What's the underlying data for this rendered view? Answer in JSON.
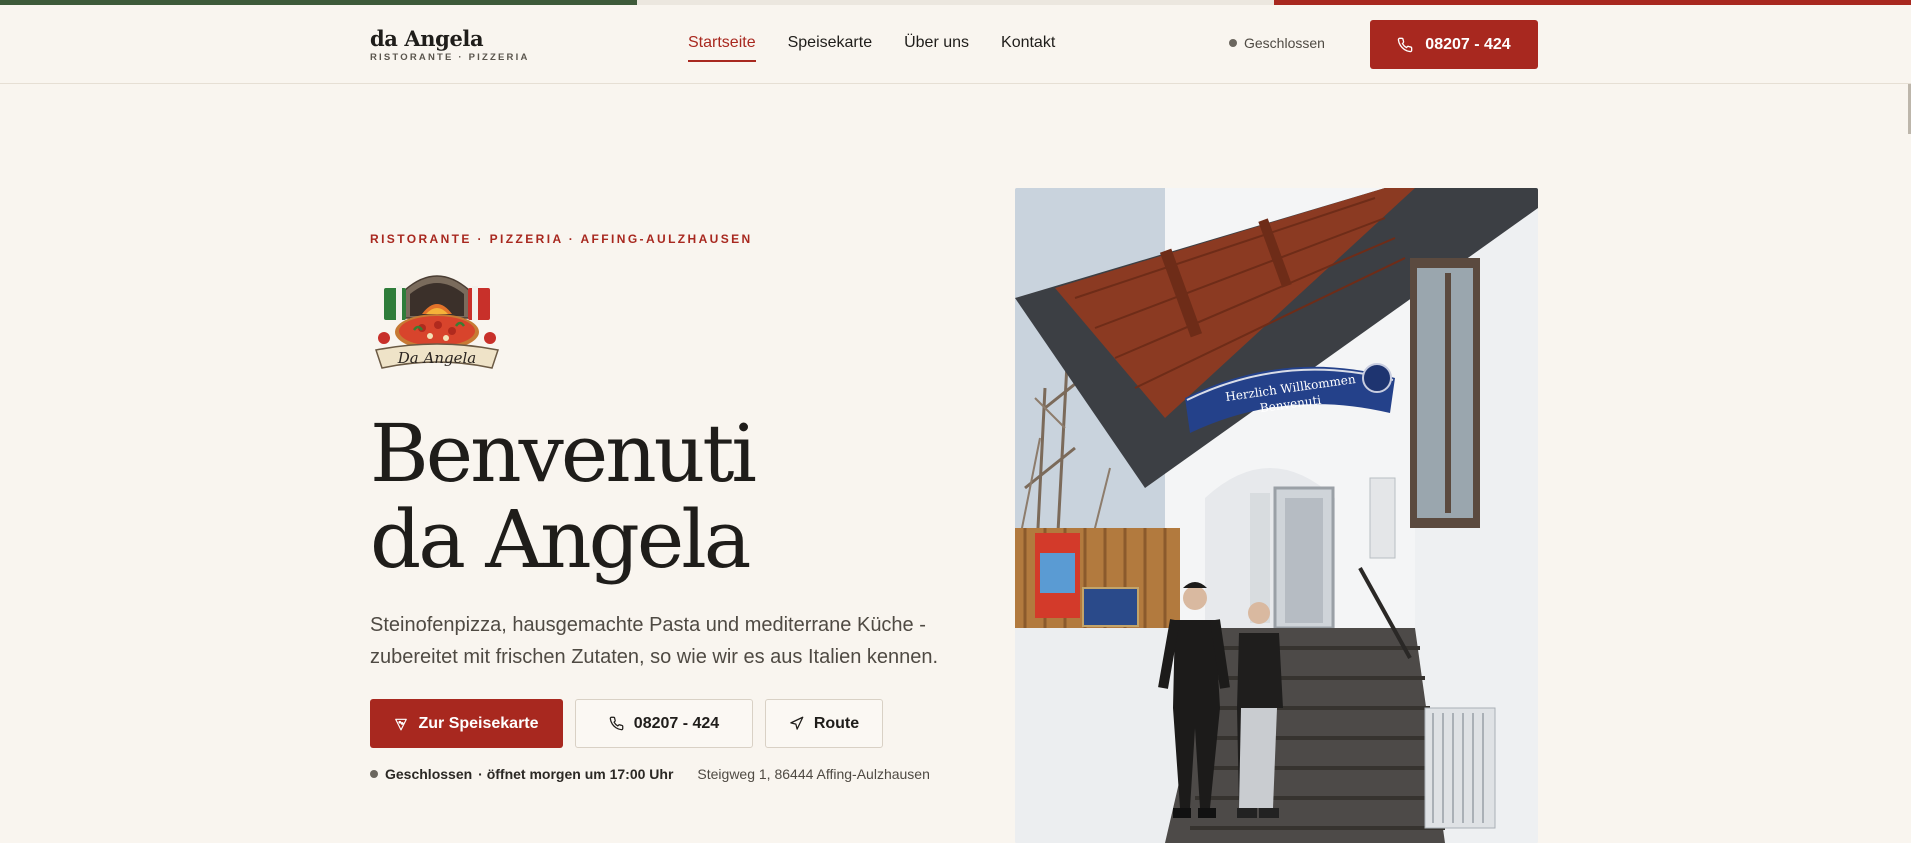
{
  "colors": {
    "accent": "#a8281f",
    "background": "#f9f5ef",
    "flag_green": "#3e5a3a",
    "flag_white": "#f2efe9",
    "flag_red": "#a8281f"
  },
  "header": {
    "brand_name": "da Angela",
    "brand_sub": "RISTORANTE · PIZZERIA",
    "nav": [
      {
        "label": "Startseite",
        "active": true
      },
      {
        "label": "Speisekarte",
        "active": false
      },
      {
        "label": "Über uns",
        "active": false
      },
      {
        "label": "Kontakt",
        "active": false
      }
    ],
    "status": "Geschlossen",
    "phone_button": "08207 - 424",
    "phone_icon": "phone-icon"
  },
  "hero": {
    "eyebrow": "RISTORANTE · PIZZERIA · AFFING-AULZHAUSEN",
    "logo_text": "Da Angela",
    "headline_line1": "Benvenuti",
    "headline_line2": "da Angela",
    "lead": "Steinofenpizza, hausgemachte Pasta und mediterrane Küche - zubereitet mit frischen Zutaten, so wie wir es aus Italien kennen.",
    "buttons": {
      "menu": "Zur Speisekarte",
      "menu_icon": "pizza-slice-icon",
      "phone": "08207 - 424",
      "phone_icon": "phone-icon",
      "route": "Route",
      "route_icon": "navigation-arrow-icon"
    },
    "meta": {
      "status": "Geschlossen",
      "opens": "· öffnet morgen um 17:00 Uhr",
      "address": "Steigweg 1, 86444 Affing-Aulzhausen"
    },
    "photo": {
      "sign_line1": "Herzlich Willkommen",
      "sign_line2": "Benvenuti"
    }
  }
}
